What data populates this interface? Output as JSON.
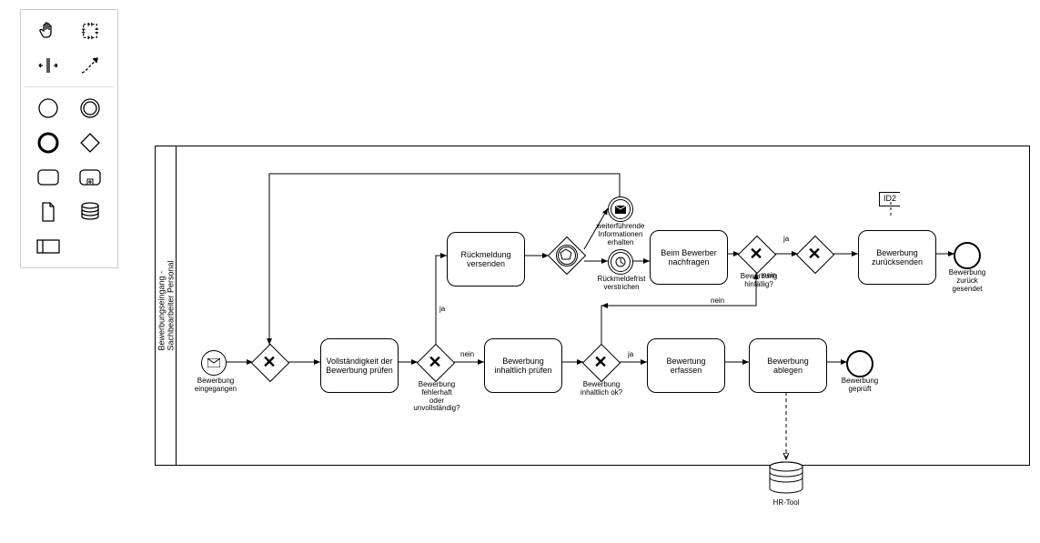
{
  "pool": {
    "label": "Bewerbungseingang -\nSachbearbeiter Personal"
  },
  "events": {
    "start_label": "Bewerbung\neingegangen",
    "intermediate_msg_label": "weiterführende\nInformationen\nerhalten",
    "intermediate_timer_label": "Rückmeldefrist\nverstrichen",
    "end_sent_label": "Bewerbung\nzurück\ngesendet",
    "end_checked_label": "Bewerbung\ngeprüft"
  },
  "tasks": {
    "check_complete": "Vollständigkeit der Bewerbung prüfen",
    "send_feedback": "Rückmeldung versenden",
    "check_content": "Bewerbung inhaltlich prüfen",
    "ask_applicant": "Beim Bewerber nachfragen",
    "record_rating": "Bewertung erfassen",
    "file_application": "Bewerbung ablegen",
    "send_back": "Bewerbung zurücksenden"
  },
  "gateways": {
    "g1_label": "",
    "g2_label": "Bewerbung\nfehlerhaft\noder\nunvollständig?",
    "g3_label": "Bewerbung\ninhaltlich ok?",
    "g4_label": "Bewerbung\nhinfällig?",
    "g5_label": ""
  },
  "edges": {
    "ja": "ja",
    "nein": "nein"
  },
  "datastore": {
    "label": "HR-Tool"
  },
  "annotation": {
    "text": "ID2"
  },
  "palette": {
    "hand": "hand-tool",
    "lasso": "lasso-tool",
    "space": "space-tool",
    "connect": "global-connect-tool",
    "start_event": "create-start-event",
    "intermediate_event": "create-intermediate-event",
    "end_event": "create-end-event",
    "gateway": "create-exclusive-gateway",
    "task": "create-task",
    "subprocess": "create-subprocess",
    "data_object": "create-data-object",
    "data_store": "create-data-store",
    "participant": "create-participant"
  }
}
